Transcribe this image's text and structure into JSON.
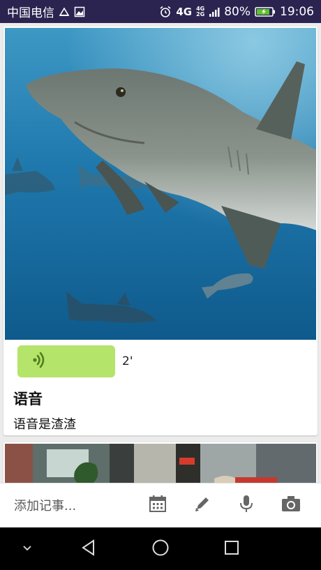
{
  "status_bar": {
    "carrier": "中国电信",
    "network_main": "4G",
    "network_top": "4G",
    "network_bottom": "2G",
    "battery": "80%",
    "time": "19:06",
    "icons": [
      "lifebuoy-icon",
      "image-icon",
      "alarm-icon",
      "signal-icon",
      "battery-icon"
    ]
  },
  "notes": [
    {
      "image": "shark-underwater-photo",
      "voice_duration": "2'",
      "title": "语音",
      "body": "语音是渣渣"
    },
    {
      "image": "restaurant-interior-photo"
    }
  ],
  "input_bar": {
    "placeholder": "添加记事...",
    "tools": [
      "calendar-icon",
      "pen-icon",
      "microphone-icon",
      "camera-icon"
    ]
  },
  "nav_bar": {
    "buttons": [
      "chevron-down-icon",
      "back-icon",
      "home-icon",
      "recents-icon"
    ]
  },
  "colors": {
    "status_bar_bg": "#2b2450",
    "voice_bubble": "#b5e46a",
    "voice_icon": "#4f7f1e",
    "page_bg": "#ececec",
    "nav_bar_bg": "#000000"
  }
}
